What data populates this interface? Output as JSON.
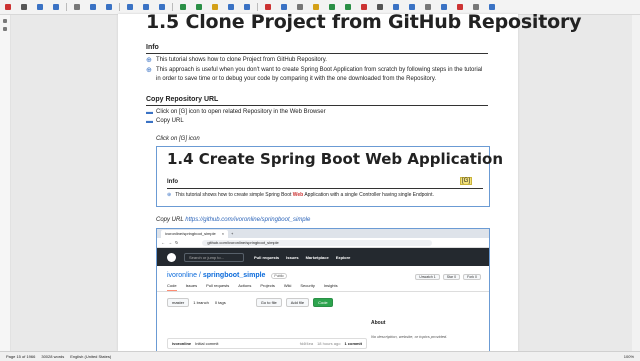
{
  "doc": {
    "heading_top": "1.5 Clone Project from GitHub Repository",
    "info_label": "Info",
    "info_bullets": [
      "This tutorial shows how to clone Project from GitHub Repository.",
      "This approach is useful when you don't want to create Spring Boot Application from scratch by following steps in the tutorial in order to save time or to debug your code by comparing it with the one downloaded from the Repository."
    ],
    "copy_repo_label": "Copy Repository URL",
    "copy_repo_steps": [
      "Click on [G] icon to open related Repository in the Web Browser",
      "Copy URL"
    ],
    "click_caption": "Click on [G] icon",
    "embedded_heading": "1.4 Create Spring Boot Web Application",
    "embedded_info": "Info",
    "embedded_g": "[G]",
    "embedded_line_pre": "This tutorial shows how to create simple Spring Boot ",
    "embedded_line_web": "Web",
    "embedded_line_post": " Application with a single Controller having single Endpoint.",
    "copy_url_caption": "Copy URL",
    "copy_url_link": "https://github.com/ivoronline/springboot_simple"
  },
  "browser": {
    "tab_title": "ivoronline/springboot_simple",
    "address": "github.com/ivoronline/springboot_simple",
    "search_placeholder": "Search or jump to...",
    "nav": [
      "Pull requests",
      "Issues",
      "Marketplace",
      "Explore"
    ],
    "repo_owner": "ivoronline",
    "repo_name": "springboot_simple",
    "visibility": "Public",
    "actions": [
      "Unwatch 1",
      "Star 0",
      "Fork 0"
    ],
    "tabs": [
      "Code",
      "Issues",
      "Pull requests",
      "Actions",
      "Projects",
      "Wiki",
      "Security",
      "Insights"
    ],
    "branch": "master",
    "branches": "1 branch",
    "tags": "0 tags",
    "go_to_file": "Go to file",
    "add_file": "Add file",
    "code_btn": "Code",
    "about": "About",
    "about_desc": "No description, website, or topics provided.",
    "commit_user": "ivoronline",
    "commit_msg": "Initial commit",
    "commit_hash": "fd4f4ea",
    "commit_time": "18 hours ago",
    "commit_count": "1 commit"
  },
  "status": {
    "page": "Page 15 of 1966",
    "words": "30028 words",
    "language": "English (United States)",
    "zoom": "100%"
  }
}
